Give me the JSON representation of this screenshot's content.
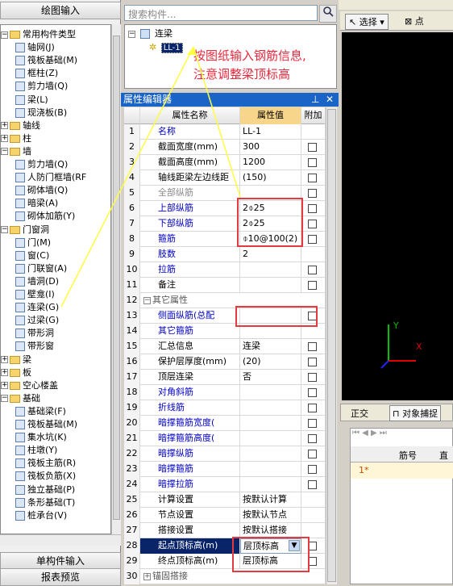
{
  "left_panel": {
    "title": "绘图输入",
    "bottom_tabs": [
      "单构件输入",
      "报表预览"
    ],
    "tree": [
      {
        "label": "常用构件类型",
        "level": 0,
        "expanded": true,
        "folder": true
      },
      {
        "label": "轴网(J)",
        "level": 1
      },
      {
        "label": "筏板基础(M)",
        "level": 1
      },
      {
        "label": "框柱(Z)",
        "level": 1
      },
      {
        "label": "剪力墙(Q)",
        "level": 1
      },
      {
        "label": "梁(L)",
        "level": 1
      },
      {
        "label": "现浇板(B)",
        "level": 1
      },
      {
        "label": "轴线",
        "level": 0,
        "expanded": false,
        "folder": true
      },
      {
        "label": "柱",
        "level": 0,
        "expanded": false,
        "folder": true
      },
      {
        "label": "墙",
        "level": 0,
        "expanded": true,
        "folder": true
      },
      {
        "label": "剪力墙(Q)",
        "level": 1
      },
      {
        "label": "人防门框墙(RF",
        "level": 1
      },
      {
        "label": "砌体墙(Q)",
        "level": 1
      },
      {
        "label": "暗梁(A)",
        "level": 1
      },
      {
        "label": "砌体加筋(Y)",
        "level": 1
      },
      {
        "label": "门窗洞",
        "level": 0,
        "expanded": true,
        "folder": true
      },
      {
        "label": "门(M)",
        "level": 1
      },
      {
        "label": "窗(C)",
        "level": 1
      },
      {
        "label": "门联窗(A)",
        "level": 1
      },
      {
        "label": "墙洞(D)",
        "level": 1
      },
      {
        "label": "壁龛(I)",
        "level": 1
      },
      {
        "label": "连梁(G)",
        "level": 1
      },
      {
        "label": "过梁(G)",
        "level": 1
      },
      {
        "label": "带形洞",
        "level": 1
      },
      {
        "label": "带形窗",
        "level": 1
      },
      {
        "label": "梁",
        "level": 0,
        "expanded": false,
        "folder": true
      },
      {
        "label": "板",
        "level": 0,
        "expanded": false,
        "folder": true
      },
      {
        "label": "空心楼盖",
        "level": 0,
        "expanded": false,
        "folder": true
      },
      {
        "label": "基础",
        "level": 0,
        "expanded": true,
        "folder": true
      },
      {
        "label": "基础梁(F)",
        "level": 1
      },
      {
        "label": "筏板基础(M)",
        "level": 1
      },
      {
        "label": "集水坑(K)",
        "level": 1
      },
      {
        "label": "柱墩(Y)",
        "level": 1
      },
      {
        "label": "筏板主筋(R)",
        "level": 1
      },
      {
        "label": "筏板负筋(X)",
        "level": 1
      },
      {
        "label": "独立基础(P)",
        "level": 1
      },
      {
        "label": "条形基础(T)",
        "level": 1
      },
      {
        "label": "桩承台(V)",
        "level": 1
      }
    ]
  },
  "component_tree": {
    "search_placeholder": "搜索构件...",
    "root": "连梁",
    "child": "LL-1"
  },
  "annotation": {
    "line1": "按图纸输入钢筋信息,",
    "line2": "注意调整梁顶标高"
  },
  "property_editor": {
    "title": "属性编辑器",
    "columns": [
      "属性名称",
      "属性值",
      "附加"
    ],
    "rows": [
      {
        "n": "1",
        "name": "名称",
        "value": "LL-1",
        "style": "blue",
        "check": false
      },
      {
        "n": "2",
        "name": "截面宽度(mm)",
        "value": "300",
        "style": "",
        "check": true
      },
      {
        "n": "3",
        "name": "截面高度(mm)",
        "value": "1200",
        "style": "",
        "check": true
      },
      {
        "n": "4",
        "name": "轴线距梁左边线距",
        "value": "(150)",
        "style": "",
        "check": true
      },
      {
        "n": "5",
        "name": "全部纵筋",
        "value": "",
        "style": "gray",
        "check": true
      },
      {
        "n": "6",
        "name": "上部纵筋",
        "value": "2⌽25",
        "style": "blue",
        "check": true
      },
      {
        "n": "7",
        "name": "下部纵筋",
        "value": "2⌽25",
        "style": "blue",
        "check": true
      },
      {
        "n": "8",
        "name": "箍筋",
        "value": "⌽10@100(2)",
        "style": "blue",
        "check": true
      },
      {
        "n": "9",
        "name": "肢数",
        "value": "2",
        "style": "blue",
        "check": false
      },
      {
        "n": "10",
        "name": "拉筋",
        "value": "",
        "style": "blue",
        "check": true
      },
      {
        "n": "11",
        "name": "备注",
        "value": "",
        "style": "",
        "check": true
      },
      {
        "n": "12",
        "name": "其它属性",
        "value": "",
        "style": "group",
        "check": false
      },
      {
        "n": "13",
        "name": "侧面纵筋(总配",
        "value": "",
        "style": "blue",
        "check": true
      },
      {
        "n": "14",
        "name": "其它箍筋",
        "value": "",
        "style": "blue",
        "check": false
      },
      {
        "n": "15",
        "name": "汇总信息",
        "value": "连梁",
        "style": "",
        "check": true
      },
      {
        "n": "16",
        "name": "保护层厚度(mm)",
        "value": "(20)",
        "style": "",
        "check": true
      },
      {
        "n": "17",
        "name": "顶层连梁",
        "value": "否",
        "style": "",
        "check": true
      },
      {
        "n": "18",
        "name": "对角斜筋",
        "value": "",
        "style": "blue",
        "check": true
      },
      {
        "n": "19",
        "name": "折线筋",
        "value": "",
        "style": "blue",
        "check": true
      },
      {
        "n": "20",
        "name": "暗撑箍筋宽度(",
        "value": "",
        "style": "blue",
        "check": true
      },
      {
        "n": "21",
        "name": "暗撑箍筋高度(",
        "value": "",
        "style": "blue",
        "check": true
      },
      {
        "n": "22",
        "name": "暗撑纵筋",
        "value": "",
        "style": "blue",
        "check": true
      },
      {
        "n": "23",
        "name": "暗撑箍筋",
        "value": "",
        "style": "blue",
        "check": true
      },
      {
        "n": "24",
        "name": "暗撑拉筋",
        "value": "",
        "style": "blue",
        "check": true
      },
      {
        "n": "25",
        "name": "计算设置",
        "value": "按默认计算",
        "style": "",
        "check": false
      },
      {
        "n": "26",
        "name": "节点设置",
        "value": "按默认节点",
        "style": "",
        "check": false
      },
      {
        "n": "27",
        "name": "搭接设置",
        "value": "按默认搭接",
        "style": "",
        "check": false
      },
      {
        "n": "28",
        "name": "起点顶标高(m)",
        "value": "层顶标高",
        "style": "selected",
        "check": true
      },
      {
        "n": "29",
        "name": "终点顶标高(m)",
        "value": "层顶标高",
        "style": "",
        "check": true
      },
      {
        "n": "30",
        "name": "锚固搭接",
        "value": "",
        "style": "group",
        "check": false
      }
    ]
  },
  "right_panel": {
    "select_label": "选择",
    "point_label": "点",
    "view_tab": "正交",
    "snap_tab": "对象捕捉",
    "table_header": "筋号",
    "table_header2": "直径",
    "row1": "1*",
    "axis_y": "Y",
    "axis_x": "X"
  }
}
